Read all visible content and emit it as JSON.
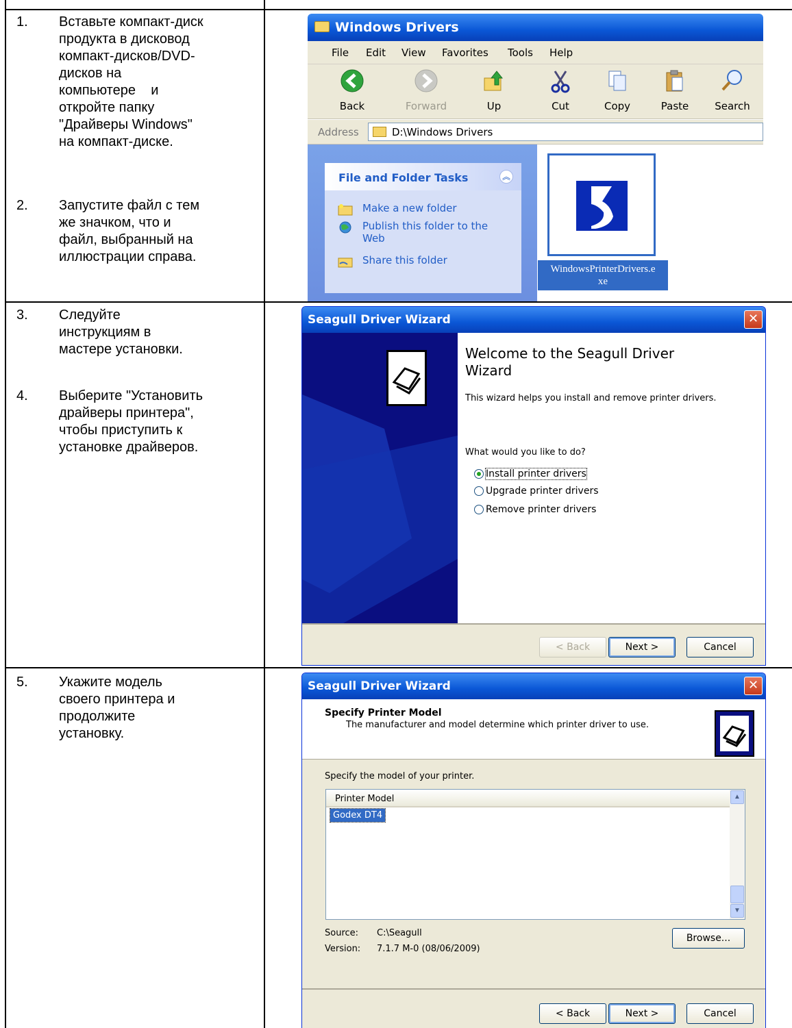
{
  "doc": {
    "steps": [
      {
        "num": "1.",
        "lines": [
          "Вставьте компакт-диск",
          "продукта в дисковод",
          "компакт-дисков/DVD-",
          "дисков на",
          "компьютере    и",
          "откройте папку",
          "\"Драйверы Windows\"",
          "на компакт-диске."
        ]
      },
      {
        "num": "2.",
        "lines": [
          "Запустите файл с тем",
          "же значком, что и",
          "файл, выбранный на",
          "иллюстрации справа."
        ]
      },
      {
        "num": "3.",
        "lines": [
          "Следуйте",
          "инструкциям в",
          "мастере установки."
        ]
      },
      {
        "num": "4.",
        "lines": [
          "Выберите \"Установить",
          "драйверы принтера\",",
          "чтобы приступить к",
          "установке драйверов."
        ]
      },
      {
        "num": "5.",
        "lines": [
          "Укажите модель",
          "своего принтера и",
          "продолжите",
          "установку."
        ]
      }
    ]
  },
  "explorer": {
    "title": "Windows Drivers",
    "menu": [
      "File",
      "Edit",
      "View",
      "Favorites",
      "Tools",
      "Help"
    ],
    "toolbar": [
      "Back",
      "Forward",
      "Up",
      "Cut",
      "Copy",
      "Paste",
      "Search"
    ],
    "address_label": "Address",
    "address_value": "D:\\Windows Drivers",
    "task_header": "File and Folder Tasks",
    "tasks": [
      "Make a new folder",
      "Publish this folder to the",
      "Web",
      "Share this folder"
    ],
    "file_name_1": "WindowsPrinterDrivers.e",
    "file_name_2": "xe"
  },
  "wizard1": {
    "title": "Seagull Driver Wizard",
    "close": "✕",
    "heading_1": "Welcome to the Seagull Driver",
    "heading_2": "Wizard",
    "intro": "This wizard helps you install and remove printer drivers.",
    "question": "What would you like to do?",
    "options": [
      "Install printer drivers",
      "Upgrade printer drivers",
      "Remove printer drivers"
    ],
    "selected_index": 0,
    "buttons": {
      "back": "< Back",
      "next": "Next >",
      "cancel": "Cancel"
    }
  },
  "wizard2": {
    "title": "Seagull Driver Wizard",
    "close": "✕",
    "heading": "Specify Printer Model",
    "subheading": "The manufacturer and model determine which printer driver to use.",
    "prompt": "Specify the model of your printer.",
    "list_header": "Printer Model",
    "list_items": [
      "Godex DT4"
    ],
    "source_label": "Source:",
    "source_value": "C:\\Seagull",
    "version_label": "Version:",
    "version_value": "7.1.7 M-0 (08/06/2009)",
    "browse": "Browse...",
    "buttons": {
      "back": "< Back",
      "next": "Next >",
      "cancel": "Cancel"
    }
  },
  "colors": {
    "xp_blue": "#0a57d6",
    "wizard_side": "#0a0e80",
    "selection": "#316ac5"
  }
}
